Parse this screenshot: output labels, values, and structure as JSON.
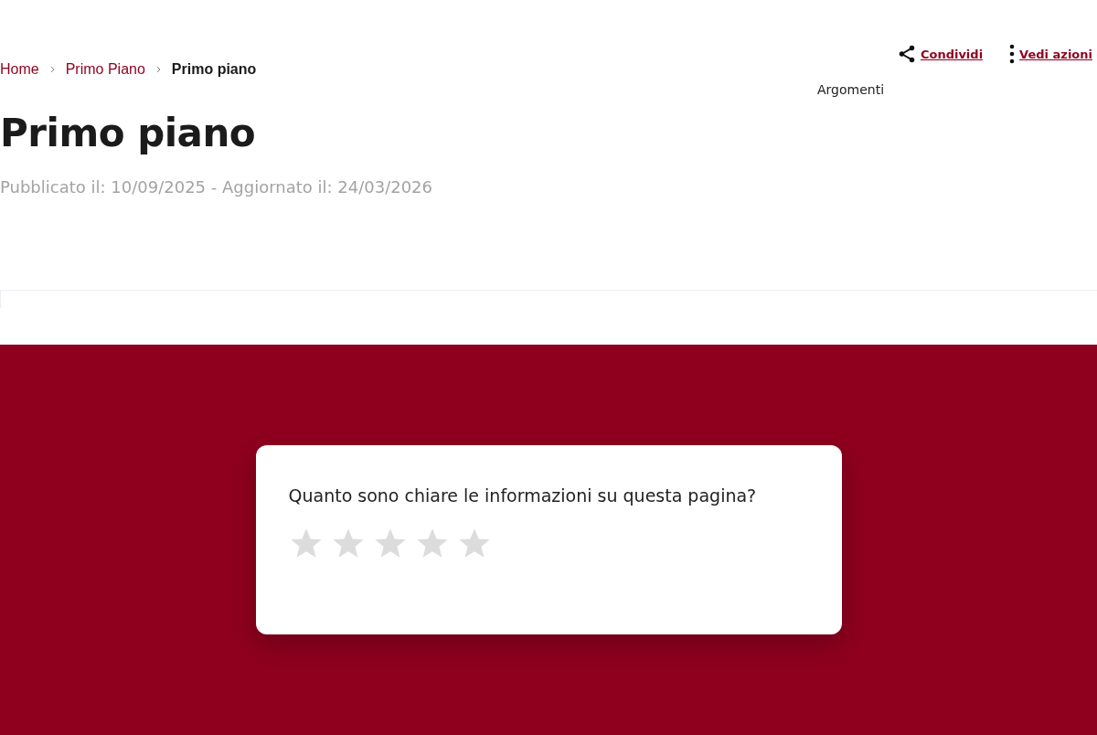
{
  "breadcrumb": [
    {
      "label": "Home",
      "current": false
    },
    {
      "label": "Primo Piano",
      "current": false
    },
    {
      "label": "Primo piano",
      "current": true
    }
  ],
  "actions": [
    {
      "kind": "share",
      "label": "Condividi"
    },
    {
      "kind": "more",
      "label": "Vedi azioni"
    }
  ],
  "topics_label": "Argomenti",
  "title": "Primo piano",
  "meta": "Pubblicato il: 10/09/2025 - Aggiornato il: 24/03/2026",
  "rating": {
    "question": "Quanto sono chiare le informazioni su questa pagina?",
    "stars": 0
  }
}
